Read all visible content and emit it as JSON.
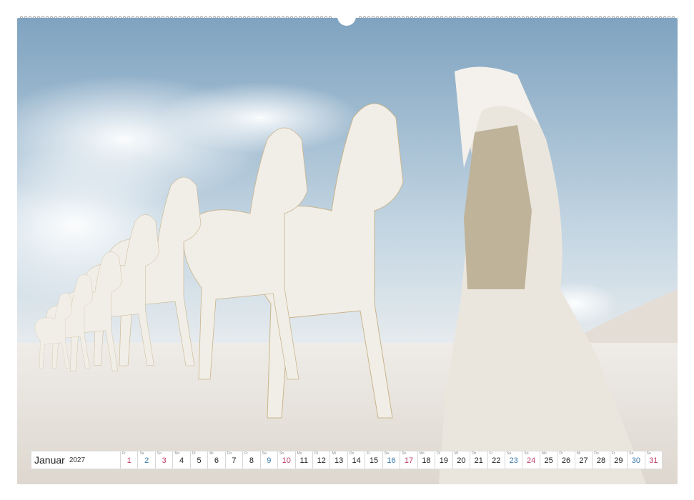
{
  "calendar": {
    "month": "Januar",
    "year": "2027",
    "days": [
      {
        "wd": "Fr",
        "n": "1",
        "t": "sun"
      },
      {
        "wd": "Sa",
        "n": "2",
        "t": "sat"
      },
      {
        "wd": "So",
        "n": "3",
        "t": "sun"
      },
      {
        "wd": "Mo",
        "n": "4",
        "t": ""
      },
      {
        "wd": "Di",
        "n": "5",
        "t": ""
      },
      {
        "wd": "Mi",
        "n": "6",
        "t": ""
      },
      {
        "wd": "Do",
        "n": "7",
        "t": ""
      },
      {
        "wd": "Fr",
        "n": "8",
        "t": ""
      },
      {
        "wd": "Sa",
        "n": "9",
        "t": "sat"
      },
      {
        "wd": "So",
        "n": "10",
        "t": "sun"
      },
      {
        "wd": "Mo",
        "n": "11",
        "t": ""
      },
      {
        "wd": "Di",
        "n": "12",
        "t": ""
      },
      {
        "wd": "Mi",
        "n": "13",
        "t": ""
      },
      {
        "wd": "Do",
        "n": "14",
        "t": ""
      },
      {
        "wd": "Fr",
        "n": "15",
        "t": ""
      },
      {
        "wd": "Sa",
        "n": "16",
        "t": "sat"
      },
      {
        "wd": "So",
        "n": "17",
        "t": "sun"
      },
      {
        "wd": "Mo",
        "n": "18",
        "t": ""
      },
      {
        "wd": "Di",
        "n": "19",
        "t": ""
      },
      {
        "wd": "Mi",
        "n": "20",
        "t": ""
      },
      {
        "wd": "Do",
        "n": "21",
        "t": ""
      },
      {
        "wd": "Fr",
        "n": "22",
        "t": ""
      },
      {
        "wd": "Sa",
        "n": "23",
        "t": "sat"
      },
      {
        "wd": "So",
        "n": "24",
        "t": "sun"
      },
      {
        "wd": "Mo",
        "n": "25",
        "t": ""
      },
      {
        "wd": "Di",
        "n": "26",
        "t": ""
      },
      {
        "wd": "Mi",
        "n": "27",
        "t": ""
      },
      {
        "wd": "Do",
        "n": "28",
        "t": ""
      },
      {
        "wd": "Fr",
        "n": "29",
        "t": ""
      },
      {
        "wd": "Sa",
        "n": "30",
        "t": "sat"
      },
      {
        "wd": "So",
        "n": "31",
        "t": "sun"
      }
    ]
  },
  "colors": {
    "sky_top": "#7fa3c0",
    "sand": "#e9e5df",
    "saturday": "#3a79a8",
    "sunday": "#c0406e"
  }
}
